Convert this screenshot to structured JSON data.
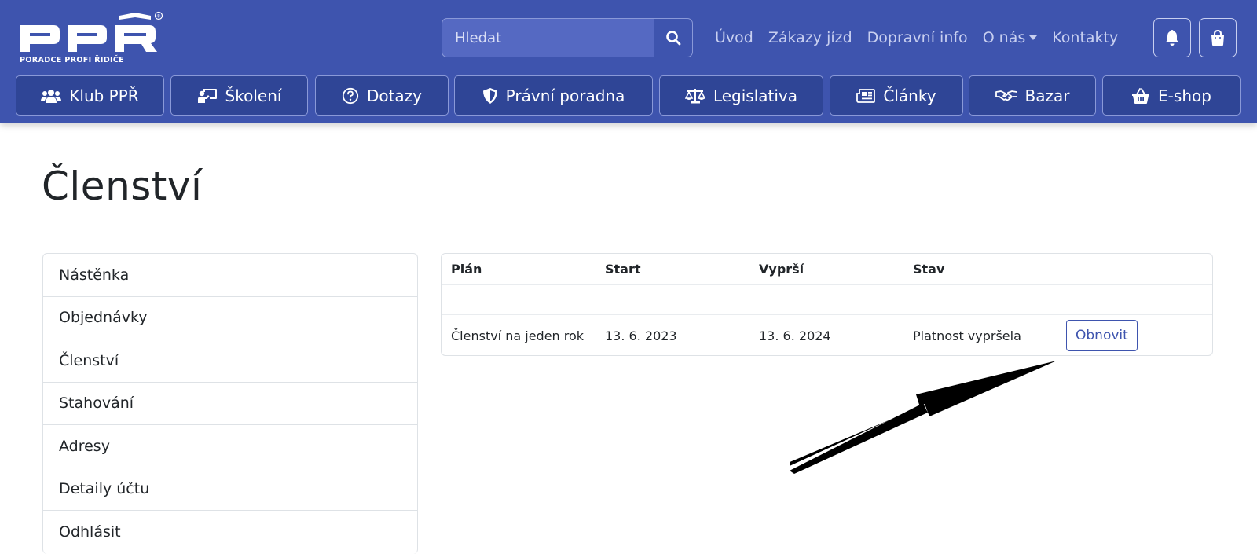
{
  "header": {
    "logo": {
      "text": "PPŘ",
      "subtitle": "PORADCE PROFI ŘIDIČE",
      "mark": "®"
    },
    "search": {
      "placeholder": "Hledat",
      "icon": "search-icon"
    },
    "top_links": [
      {
        "label": "Úvod"
      },
      {
        "label": "Zákazy jízd"
      },
      {
        "label": "Dopravní info"
      },
      {
        "label": "O nás",
        "dropdown": true
      },
      {
        "label": "Kontakty"
      }
    ],
    "icons": [
      "bell-icon",
      "shopping-bag-icon"
    ],
    "main_nav": [
      {
        "label": "Klub PPŘ",
        "icon": "users-icon"
      },
      {
        "label": "Školení",
        "icon": "teacher-board-icon"
      },
      {
        "label": "Dotazy",
        "icon": "question-circle-icon"
      },
      {
        "label": "Právní poradna",
        "icon": "shield-icon"
      },
      {
        "label": "Legislativa",
        "icon": "scales-icon"
      },
      {
        "label": "Články",
        "icon": "newspaper-icon"
      },
      {
        "label": "Bazar",
        "icon": "handshake-icon"
      },
      {
        "label": "E-shop",
        "icon": "basket-icon"
      }
    ]
  },
  "page": {
    "title": "Členství"
  },
  "sidebar": {
    "items": [
      {
        "label": "Nástěnka"
      },
      {
        "label": "Objednávky"
      },
      {
        "label": "Členství"
      },
      {
        "label": "Stahování"
      },
      {
        "label": "Adresy"
      },
      {
        "label": "Detaily účtu"
      },
      {
        "label": "Odhlásit"
      }
    ]
  },
  "membership_table": {
    "columns": [
      "Plán",
      "Start",
      "Vyprší",
      "Stav",
      ""
    ],
    "rows": [
      {
        "plan": "Členství na jeden rok",
        "start": "13. 6. 2023",
        "expires": "13. 6. 2024",
        "status": "Platnost vypršela",
        "action": "Obnovit"
      }
    ]
  },
  "colors": {
    "header_bg": "#3e54ae",
    "nav_button_bg": "#2f4596",
    "accent": "#3e54ae"
  }
}
